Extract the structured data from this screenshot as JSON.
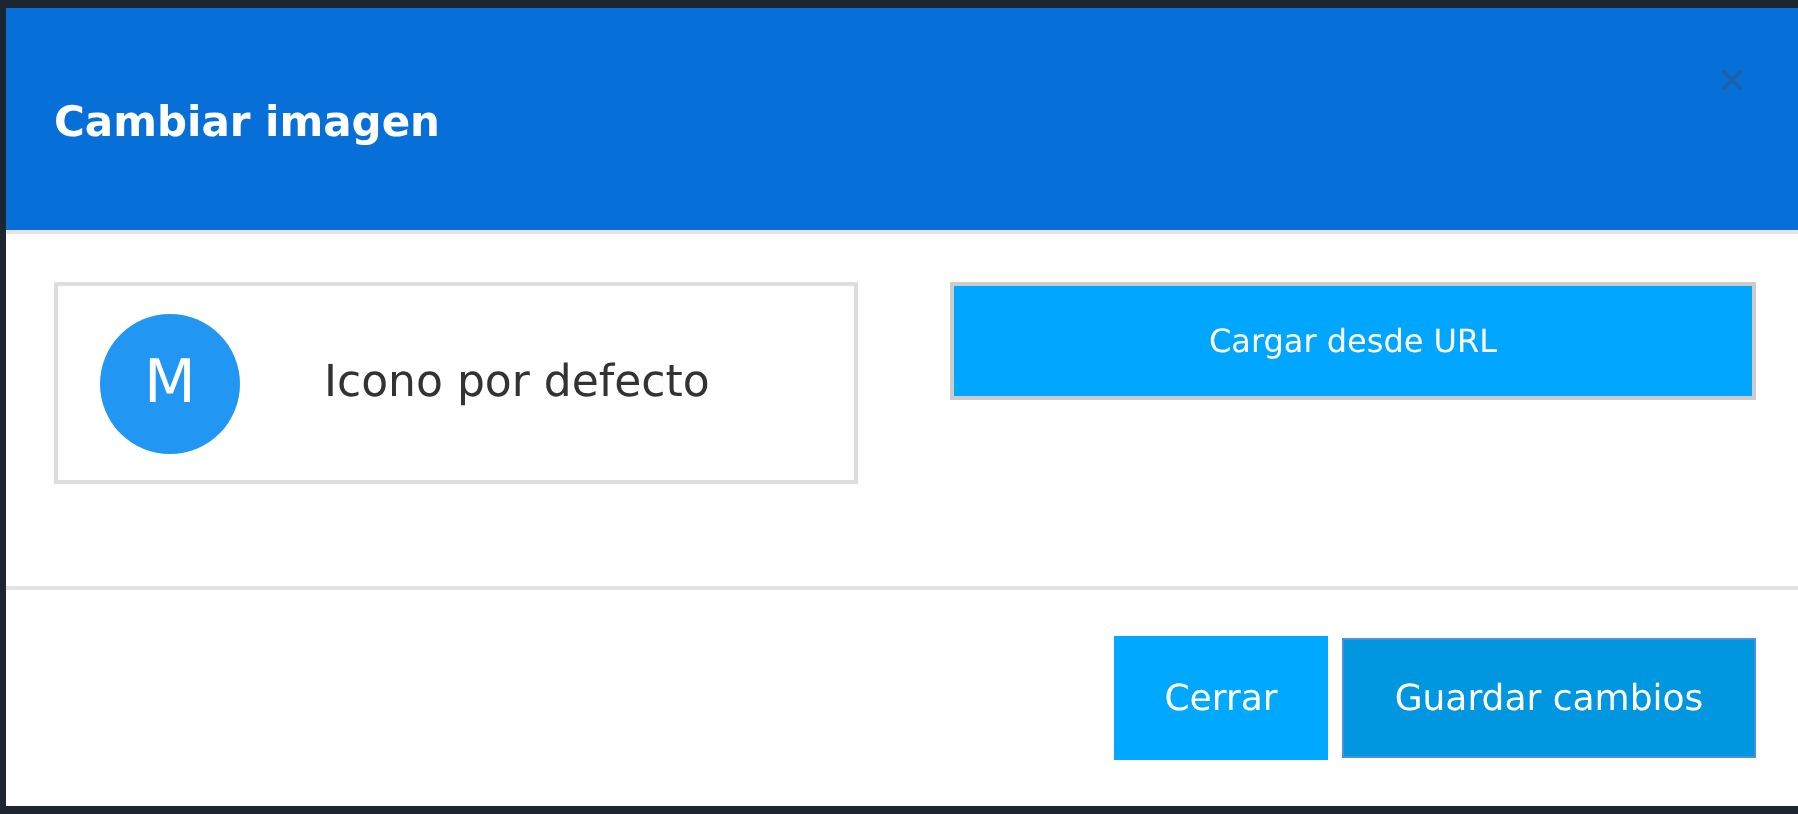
{
  "dialog": {
    "title": "Cambiar imagen",
    "close": "×"
  },
  "options": [
    {
      "kind": "default-icon",
      "avatar": "M",
      "label": "Icono por defecto"
    },
    {
      "kind": "url-button",
      "label": "Cargar desde URL"
    }
  ],
  "buttons": [
    {
      "kind": "secondary",
      "label": "Cerrar"
    },
    {
      "kind": "primary",
      "label": "Guardar cambios"
    }
  ]
}
